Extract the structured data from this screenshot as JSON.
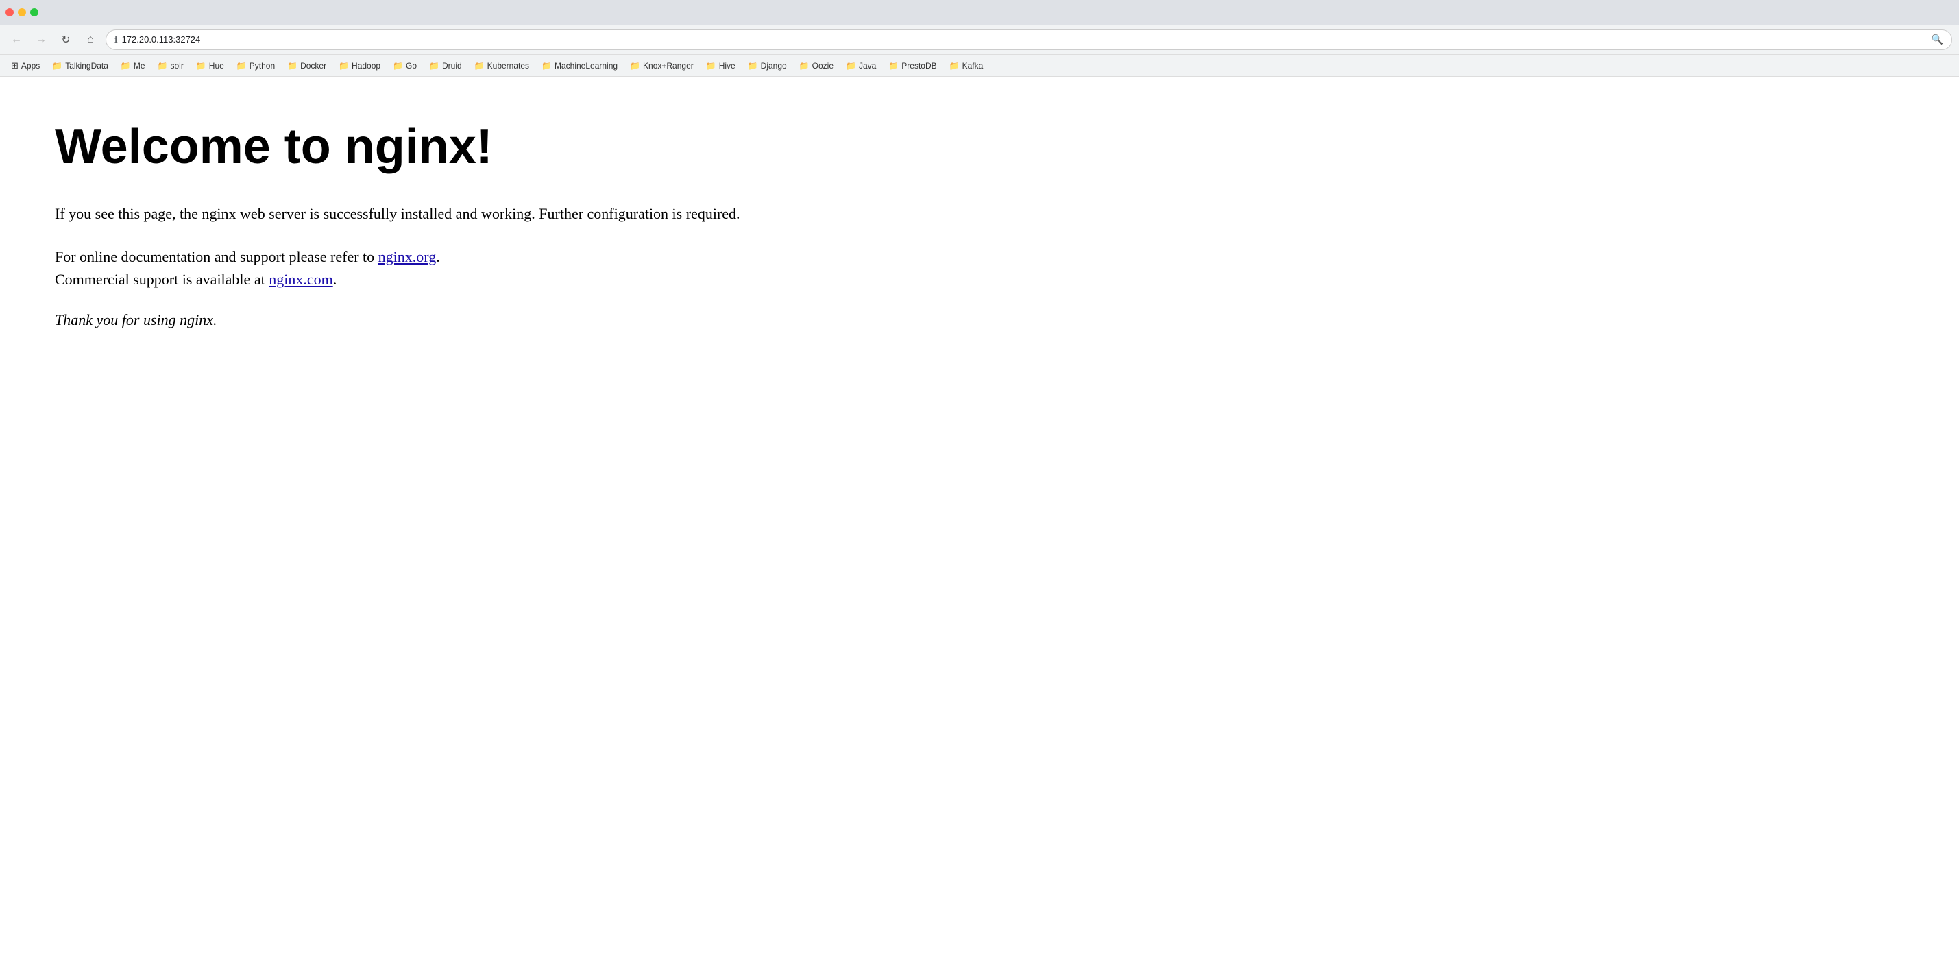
{
  "browser": {
    "url": "172.20.0.113:32724",
    "url_icon": "ℹ",
    "back_btn": "←",
    "forward_btn": "→",
    "reload_btn": "↻",
    "home_btn": "⌂"
  },
  "bookmarks": [
    {
      "id": "apps",
      "label": "Apps",
      "icon": "⊞",
      "is_apps": true
    },
    {
      "id": "talkingdata",
      "label": "TalkingData",
      "icon": "📁"
    },
    {
      "id": "me",
      "label": "Me",
      "icon": "📁"
    },
    {
      "id": "solr",
      "label": "solr",
      "icon": "📁"
    },
    {
      "id": "hue",
      "label": "Hue",
      "icon": "📁"
    },
    {
      "id": "python",
      "label": "Python",
      "icon": "📁"
    },
    {
      "id": "docker",
      "label": "Docker",
      "icon": "📁"
    },
    {
      "id": "hadoop",
      "label": "Hadoop",
      "icon": "📁"
    },
    {
      "id": "go",
      "label": "Go",
      "icon": "📁"
    },
    {
      "id": "druid",
      "label": "Druid",
      "icon": "📁"
    },
    {
      "id": "kubernetes",
      "label": "Kubernates",
      "icon": "📁"
    },
    {
      "id": "machinelearning",
      "label": "MachineLearning",
      "icon": "📁"
    },
    {
      "id": "knox-ranger",
      "label": "Knox+Ranger",
      "icon": "📁"
    },
    {
      "id": "hive",
      "label": "Hive",
      "icon": "📁"
    },
    {
      "id": "django",
      "label": "Django",
      "icon": "📁"
    },
    {
      "id": "oozie",
      "label": "Oozie",
      "icon": "📁"
    },
    {
      "id": "java",
      "label": "Java",
      "icon": "📁"
    },
    {
      "id": "prestodb",
      "label": "PrestoDB",
      "icon": "📁"
    },
    {
      "id": "kafka",
      "label": "Kafka",
      "icon": "📁"
    }
  ],
  "page": {
    "title": "Welcome to nginx!",
    "para1": "If you see this page, the nginx web server is successfully installed and working. Further configuration is required.",
    "para2_before": "For online documentation and support please refer to",
    "para2_link1_text": "nginx.org",
    "para2_link1_url": "http://nginx.org",
    "para2_mid": ".",
    "para2_line2_before": "Commercial support is available at",
    "para2_link2_text": "nginx.com",
    "para2_link2_url": "http://nginx.com",
    "para2_line2_after": ".",
    "para3": "Thank you for using nginx."
  }
}
